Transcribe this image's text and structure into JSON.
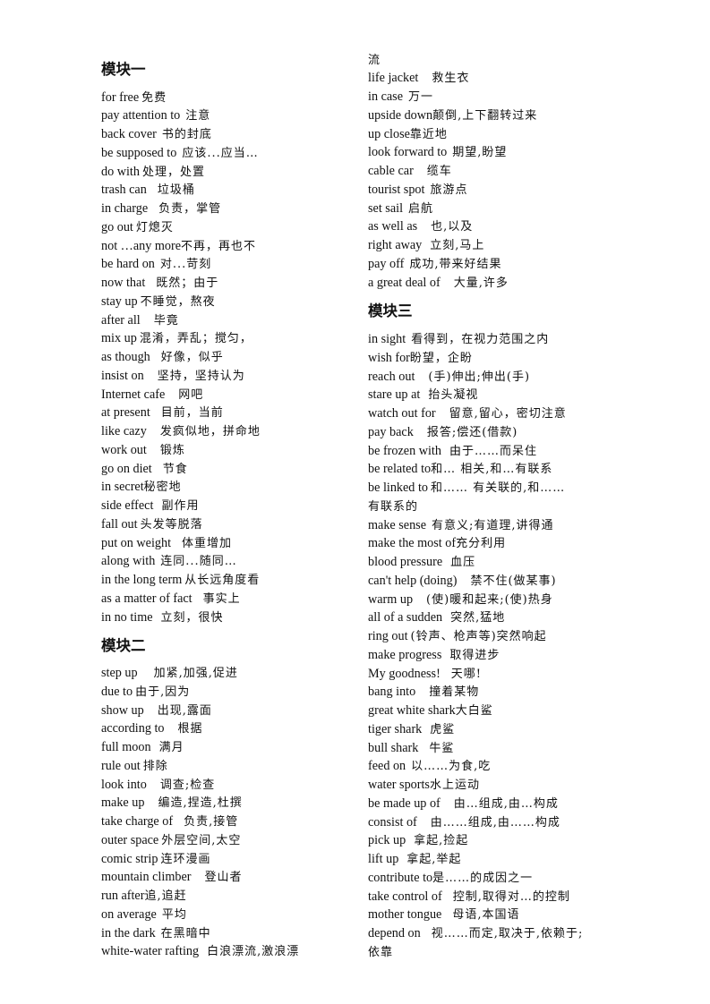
{
  "modules": [
    {
      "title": "模块一",
      "entries": [
        {
          "en": "for free",
          "zh": "免费",
          "gap": 1
        },
        {
          "en": "pay attention to",
          "zh": "注意",
          "gap": 2
        },
        {
          "en": "back cover",
          "zh": "书的封底",
          "gap": 2
        },
        {
          "en": "be supposed to",
          "zh": "应该...应当…",
          "gap": 2
        },
        {
          "en": "do with",
          "zh": "处理，处置",
          "gap": 1
        },
        {
          "en": "trash can",
          "zh": "垃圾桶",
          "gap": 4
        },
        {
          "en": "in charge",
          "zh": "负责，掌管",
          "gap": 4
        },
        {
          "en": "go out",
          "zh": "灯熄灭",
          "gap": 1
        },
        {
          "en": "not  …any more",
          "zh": "不再，再也不",
          "gap": 0
        },
        {
          "en": "be hard on",
          "zh": "对...苛刻",
          "gap": 2
        },
        {
          "en": "now that",
          "zh": "既然；由于",
          "gap": 4
        },
        {
          "en": "stay up",
          "zh": "不睡觉，熬夜",
          "gap": 1
        },
        {
          "en": "after all",
          "zh": "毕竟",
          "gap": 5
        },
        {
          "en": "mix up",
          "zh": "混淆，弄乱；搅匀，",
          "gap": 1
        },
        {
          "en": "as though",
          "zh": "好像，似乎",
          "gap": 4
        },
        {
          "en": "insist on",
          "zh": "坚持，坚持认为",
          "gap": 5
        },
        {
          "en": "Internet cafe",
          "zh": "网吧",
          "gap": 5
        },
        {
          "en": "at present",
          "zh": "目前，当前",
          "gap": 4
        },
        {
          "en": "like cazy",
          "zh": "发疯似地，拼命地",
          "gap": 5
        },
        {
          "en": "work out",
          "zh": "锻炼",
          "gap": 5
        },
        {
          "en": "go on diet",
          "zh": "节食",
          "gap": 4
        },
        {
          "en": "in secret",
          "zh": "秘密地",
          "gap": 0
        },
        {
          "en": "side effect",
          "zh": "副作用",
          "gap": 3
        },
        {
          "en": "fall out",
          "zh": "头发等脱落",
          "gap": 1
        },
        {
          "en": "put on weight",
          "zh": "体重增加",
          "gap": 4
        },
        {
          "en": "along with",
          "zh": "连同...随同…",
          "gap": 2
        },
        {
          "en": "in the long term",
          "zh": "从长远角度看",
          "gap": 1
        },
        {
          "en": "as a matter of fact",
          "zh": "事实上",
          "gap": 4
        },
        {
          "en": "in no time",
          "zh": "立刻，很快",
          "gap": 3
        }
      ]
    },
    {
      "title": "模块二",
      "entries": [
        {
          "en": "step up",
          "zh": "加紧,加强,促进",
          "gap": 6
        },
        {
          "en": "due to",
          "zh": "由于,因为",
          "gap": 1
        },
        {
          "en": "show up",
          "zh": "出现,露面",
          "gap": 5
        },
        {
          "en": "according to",
          "zh": "根据",
          "gap": 5
        },
        {
          "en": "full moon",
          "zh": "满月",
          "gap": 3
        },
        {
          "en": "rule out",
          "zh": "排除",
          "gap": 1
        },
        {
          "en": "look into",
          "zh": "调查;检查",
          "gap": 5
        },
        {
          "en": "make up",
          "zh": "编造,捏造,杜撰",
          "gap": 5
        },
        {
          "en": "take charge of",
          "zh": "负责,接管",
          "gap": 4
        },
        {
          "en": "outer space",
          "zh": "外层空间,太空",
          "gap": 1
        },
        {
          "en": "comic strip",
          "zh": "连环漫画",
          "gap": 1
        },
        {
          "en": "mountain climber",
          "zh": "登山者",
          "gap": 5
        },
        {
          "en": "run after",
          "zh": "追,追赶",
          "gap": 0
        },
        {
          "en": "on average",
          "zh": "平均",
          "gap": 2
        },
        {
          "en": "in the dark",
          "zh": "在黑暗中",
          "gap": 2
        },
        {
          "en": "white-water rafting",
          "zh": "白浪漂流,激浪漂",
          "gap": 3
        },
        {
          "en": "",
          "zh": "流",
          "gap": 0
        },
        {
          "en": "life jacket",
          "zh": "救生衣",
          "gap": 5
        },
        {
          "en": "in case",
          "zh": "万一",
          "gap": 2
        },
        {
          "en": "upside down",
          "zh": "颠倒,上下翻转过来",
          "gap": 0
        },
        {
          "en": "up close",
          "zh": "靠近地",
          "gap": 0
        },
        {
          "en": "look forward to",
          "zh": "期望,盼望",
          "gap": 2
        },
        {
          "en": "cable car",
          "zh": "缆车",
          "gap": 5
        },
        {
          "en": "tourist spot",
          "zh": "旅游点",
          "gap": 2
        },
        {
          "en": "set sail",
          "zh": "启航",
          "gap": 2
        },
        {
          "en": "as well as",
          "zh": "也,以及",
          "gap": 5
        },
        {
          "en": "right away",
          "zh": "立刻,马上",
          "gap": 3
        },
        {
          "en": "pay off",
          "zh": "成功,带来好结果",
          "gap": 2
        },
        {
          "en": "a great deal of",
          "zh": "大量,许多",
          "gap": 5
        }
      ]
    },
    {
      "title": "模块三",
      "entries": [
        {
          "en": "in sight",
          "zh": "看得到，在视力范围之内",
          "gap": 2
        },
        {
          "en": "wish for",
          "zh": "盼望，企盼",
          "gap": 0
        },
        {
          "en": "reach out",
          "zh": "(手)伸出;伸出(手)",
          "gap": 5
        },
        {
          "en": "stare up at",
          "zh": "抬头凝视",
          "gap": 3
        },
        {
          "en": "watch out for",
          "zh": "留意,留心，密切注意",
          "gap": 5
        },
        {
          "en": "pay back",
          "zh": "报答;偿还(借款)",
          "gap": 5
        },
        {
          "en": "be frozen with",
          "zh": "由于……而呆住",
          "gap": 3
        },
        {
          "en": "be related to",
          "zh": "和…  相关,和…有联系",
          "gap": 0
        },
        {
          "en": "be linked to",
          "zh": "和……  有关联的,和……",
          "gap": 1
        },
        {
          "en": "",
          "zh": "有联系的",
          "gap": 0
        },
        {
          "en": "make sense",
          "zh": "有意义;有道理,讲得通",
          "gap": 2
        },
        {
          "en": "make the most of",
          "zh": "充分利用",
          "gap": 0
        },
        {
          "en": "blood pressure",
          "zh": "血压",
          "gap": 3
        },
        {
          "en": "can't help (doing)",
          "zh": "禁不住(做某事)",
          "gap": 5
        },
        {
          "en": "warm up",
          "zh": "(使)暖和起来;(使)热身",
          "gap": 5
        },
        {
          "en": "all of a sudden",
          "zh": "突然,猛地",
          "gap": 3
        },
        {
          "en": "ring out",
          "zh": "(铃声、枪声等)突然响起",
          "gap": 1
        },
        {
          "en": "make progress",
          "zh": "取得进步",
          "gap": 3
        },
        {
          "en": "My goodness!",
          "zh": "天哪!",
          "gap": 4
        },
        {
          "en": "bang into",
          "zh": "撞着某物",
          "gap": 5
        },
        {
          "en": "great white shark",
          "zh": "大白鲨",
          "gap": 0
        },
        {
          "en": "tiger shark",
          "zh": "虎鲨",
          "gap": 3
        },
        {
          "en": "bull shark",
          "zh": "牛鲨",
          "gap": 4
        },
        {
          "en": "feed on",
          "zh": "以……为食,吃",
          "gap": 2
        },
        {
          "en": "water sports",
          "zh": "水上运动",
          "gap": 0
        },
        {
          "en": "be made up of",
          "zh": "由…组成,由…构成",
          "gap": 5
        },
        {
          "en": "consist of",
          "zh": "由……组成,由……构成",
          "gap": 5
        },
        {
          "en": "pick up",
          "zh": "拿起,捡起",
          "gap": 3
        },
        {
          "en": "lift up",
          "zh": "拿起,举起",
          "gap": 3
        },
        {
          "en": "contribute to",
          "zh": "是……的成因之一",
          "gap": 0
        },
        {
          "en": "take control of",
          "zh": "控制,取得对…的控制",
          "gap": 4
        },
        {
          "en": "mother tongue",
          "zh": "母语,本国语",
          "gap": 4
        },
        {
          "en": "depend on",
          "zh": "视……而定,取决于,依赖于;",
          "gap": 4
        },
        {
          "en": "",
          "zh": "依靠",
          "gap": 0
        }
      ]
    }
  ]
}
